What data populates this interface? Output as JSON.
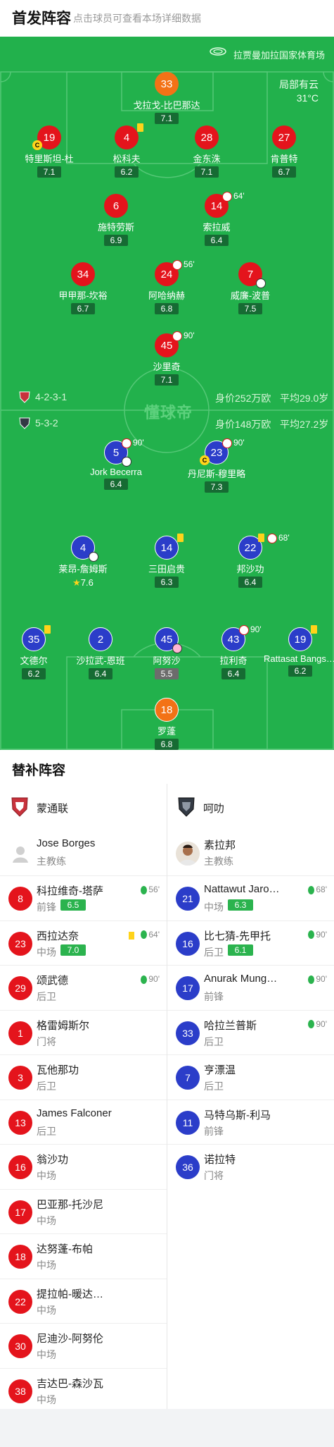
{
  "header": {
    "title": "首发阵容",
    "subtitle": "点击球员可查看本场详细数据"
  },
  "venue": "拉贾曼加拉国家体育场",
  "weather": {
    "condition": "局部有云",
    "temp": "31°C"
  },
  "logo_text": "懂球帝",
  "home_team": {
    "name": "蒙通联",
    "formation": "4-2-3-1",
    "value": "身价252万欧",
    "avg_age": "平均29.0岁",
    "coach": {
      "name": "Jose Borges",
      "role": "主教练"
    },
    "starters": [
      {
        "num": "33",
        "name": "戈拉戈-比巴那达",
        "rating": "7.1",
        "gk": true
      },
      {
        "num": "19",
        "name": "特里斯坦-杜",
        "rating": "7.1",
        "captain": true
      },
      {
        "num": "4",
        "name": "松科夫",
        "rating": "6.2",
        "yellow": true
      },
      {
        "num": "28",
        "name": "金东洙",
        "rating": "7.1"
      },
      {
        "num": "27",
        "name": "肯普特",
        "rating": "6.7"
      },
      {
        "num": "6",
        "name": "施特劳斯",
        "rating": "6.9"
      },
      {
        "num": "14",
        "name": "索拉威",
        "rating": "6.4",
        "sub_off": "64'"
      },
      {
        "num": "34",
        "name": "甲甲那-坎裕",
        "rating": "6.7"
      },
      {
        "num": "24",
        "name": "阿哈纳赫",
        "rating": "6.8",
        "sub_off": "56'"
      },
      {
        "num": "7",
        "name": "威廉-波普",
        "rating": "7.5",
        "goal": true
      },
      {
        "num": "45",
        "name": "沙里奇",
        "rating": "7.1",
        "sub_off": "90'"
      }
    ],
    "subs": [
      {
        "num": "8",
        "name": "科拉维奇-塔萨",
        "pos": "前锋",
        "rating": "6.5",
        "sub_on": "56'"
      },
      {
        "num": "23",
        "name": "西拉达奈",
        "pos": "中场",
        "rating": "7.0",
        "sub_on": "64'",
        "yellow": true
      },
      {
        "num": "29",
        "name": "颂武德",
        "pos": "后卫",
        "sub_on": "90'"
      },
      {
        "num": "1",
        "name": "格雷姆斯尔",
        "pos": "门将"
      },
      {
        "num": "3",
        "name": "瓦他那功",
        "pos": "后卫"
      },
      {
        "num": "13",
        "name": "James Falconer",
        "pos": "后卫"
      },
      {
        "num": "16",
        "name": "翁沙功",
        "pos": "中场"
      },
      {
        "num": "17",
        "name": "巴亚那-托沙尼",
        "pos": "中场"
      },
      {
        "num": "18",
        "name": "达努蓬-布帕",
        "pos": "中场"
      },
      {
        "num": "22",
        "name": "提拉帕-暖达…",
        "pos": "中场"
      },
      {
        "num": "30",
        "name": "尼迪沙-阿努伦",
        "pos": "中场"
      },
      {
        "num": "38",
        "name": "吉达巴-森沙瓦",
        "pos": "中场"
      }
    ]
  },
  "away_team": {
    "name": "呵叻",
    "formation": "5-3-2",
    "value": "身价148万欧",
    "avg_age": "平均27.2岁",
    "coach": {
      "name": "素拉邦",
      "role": "主教练"
    },
    "starters": [
      {
        "num": "5",
        "name": "Jork Becerra",
        "rating": "6.4",
        "sub_off": "90'",
        "goal": true
      },
      {
        "num": "23",
        "name": "丹尼斯-穆里略",
        "rating": "7.3",
        "sub_off": "90'",
        "captain": true
      },
      {
        "num": "4",
        "name": "莱昂-詹姆斯",
        "rating": "7.6",
        "goal": true,
        "star": true
      },
      {
        "num": "14",
        "name": "三田启贵",
        "rating": "6.3",
        "yellow": true
      },
      {
        "num": "22",
        "name": "邦沙功",
        "rating": "6.4",
        "yellow": true,
        "sub_off": "68'"
      },
      {
        "num": "35",
        "name": "文德尔",
        "rating": "6.2",
        "yellow": true
      },
      {
        "num": "2",
        "name": "沙拉武-恩班",
        "rating": "6.4"
      },
      {
        "num": "45",
        "name": "阿努沙",
        "rating": "5.5",
        "own_goal": true
      },
      {
        "num": "43",
        "name": "拉利奇",
        "rating": "6.4",
        "sub_off": "90'"
      },
      {
        "num": "19",
        "name": "Rattasat Bangsu…",
        "rating": "6.2",
        "yellow": true
      },
      {
        "num": "18",
        "name": "罗蓬",
        "rating": "6.8",
        "gk": true
      }
    ],
    "subs": [
      {
        "num": "21",
        "name": "Nattawut Jaro…",
        "pos": "中场",
        "rating": "6.3",
        "sub_on": "68'"
      },
      {
        "num": "16",
        "name": "比七猜-先甲托",
        "pos": "后卫",
        "rating": "6.1",
        "sub_on": "90'"
      },
      {
        "num": "17",
        "name": "Anurak Mung…",
        "pos": "前锋",
        "sub_on": "90'"
      },
      {
        "num": "33",
        "name": "哈拉兰普斯",
        "pos": "后卫",
        "sub_on": "90'"
      },
      {
        "num": "7",
        "name": "亨漂温",
        "pos": "后卫"
      },
      {
        "num": "11",
        "name": "马特乌斯-利马",
        "pos": "前锋"
      },
      {
        "num": "36",
        "name": "诺拉特",
        "pos": "门将"
      }
    ]
  },
  "subs_title": "替补阵容",
  "colors": {
    "pitch": "#22b14c",
    "home": "#e4141c",
    "away": "#2b3dc9",
    "gk": "#f37216"
  }
}
